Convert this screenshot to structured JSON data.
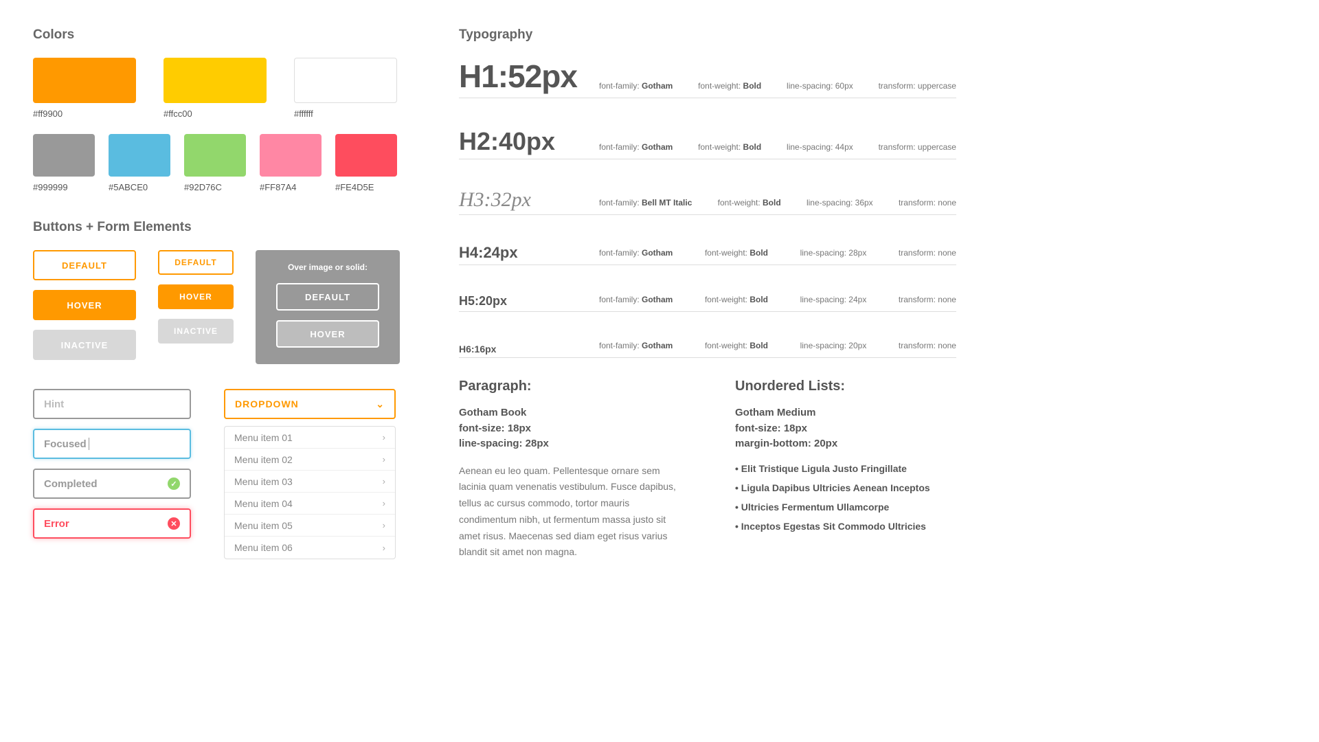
{
  "sections": {
    "colors": "Colors",
    "buttons": "Buttons + Form Elements",
    "typography": "Typography"
  },
  "colors": {
    "row1": [
      {
        "hex": "#ff9900"
      },
      {
        "hex": "#ffcc00"
      },
      {
        "hex": "#ffffff"
      }
    ],
    "row2": [
      {
        "hex": "#999999"
      },
      {
        "hex": "#5ABCE0"
      },
      {
        "hex": "#92D76C"
      },
      {
        "hex": "#FF87A4"
      },
      {
        "hex": "#FE4D5E"
      }
    ]
  },
  "buttons": {
    "default": "DEFAULT",
    "hover": "HOVER",
    "inactive": "INACTIVE",
    "overlay_title": "Over image or solid:"
  },
  "inputs": {
    "hint": "Hint",
    "focused": "Focused",
    "completed": "Completed",
    "error": "Error"
  },
  "dropdown": {
    "label": "DROPDOWN",
    "items": [
      "Menu item 01",
      "Menu item 02",
      "Menu item 03",
      "Menu item 04",
      "Menu item 05",
      "Menu item 06"
    ]
  },
  "typography": [
    {
      "sample": "H1:52px",
      "family": "Gotham",
      "weight": "Bold",
      "spacing": "60px",
      "transform": "uppercase"
    },
    {
      "sample": "H2:40px",
      "family": "Gotham",
      "weight": "Bold",
      "spacing": "44px",
      "transform": "uppercase"
    },
    {
      "sample": "H3:32px",
      "family": "Bell MT Italic",
      "weight": "Bold",
      "spacing": "36px",
      "transform": "none"
    },
    {
      "sample": "H4:24px",
      "family": "Gotham",
      "weight": "Bold",
      "spacing": "28px",
      "transform": "none"
    },
    {
      "sample": "H5:20px",
      "family": "Gotham",
      "weight": "Bold",
      "spacing": "24px",
      "transform": "none"
    },
    {
      "sample": "H6:16px",
      "family": "Gotham",
      "weight": "Bold",
      "spacing": "20px",
      "transform": "none"
    }
  ],
  "typo_labels": {
    "family": "font-family: ",
    "weight": "font-weight: ",
    "spacing": "line-spacing: ",
    "transform": "transform: "
  },
  "paragraph": {
    "title": "Paragraph:",
    "props": [
      "Gotham Book",
      "font-size: 18px",
      "line-spacing: 28px"
    ],
    "body": "Aenean eu leo quam. Pellentesque ornare sem lacinia quam venenatis vestibulum. Fusce dapibus, tellus ac cursus commodo, tortor mauris condimentum nibh, ut fermentum massa justo sit amet risus. Maecenas sed diam eget risus varius blandit sit amet non magna."
  },
  "ulist": {
    "title": "Unordered Lists:",
    "props": [
      "Gotham Medium",
      "font-size: 18px",
      "margin-bottom: 20px"
    ],
    "items": [
      "Elit Tristique Ligula Justo Fringillate",
      "Ligula Dapibus Ultricies Aenean Inceptos",
      "Ultricies Fermentum Ullamcorpe",
      "Inceptos Egestas Sit Commodo Ultricies"
    ]
  }
}
